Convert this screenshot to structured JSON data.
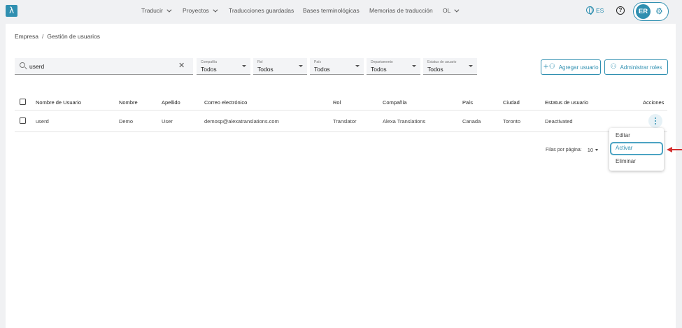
{
  "app": {
    "logo_glyph": "λ",
    "brand_color": "#2f8fb0"
  },
  "nav": {
    "items": [
      {
        "label": "Traducir",
        "has_dropdown": true
      },
      {
        "label": "Proyectos",
        "has_dropdown": true
      },
      {
        "label": "Traducciones guardadas",
        "has_dropdown": false
      },
      {
        "label": "Bases terminológicas",
        "has_dropdown": false
      },
      {
        "label": "Memorias de traducción",
        "has_dropdown": false
      },
      {
        "label": "OL",
        "has_dropdown": true
      }
    ],
    "language": "ES",
    "help_glyph": "?",
    "user_initials": "ER",
    "settings_icon": "gear-icon"
  },
  "breadcrumb": {
    "root": "Empresa",
    "separator": "/",
    "current": "Gestión de usuarios"
  },
  "search": {
    "value": "userd",
    "placeholder": ""
  },
  "filters": [
    {
      "label": "Compañía",
      "value": "Todos"
    },
    {
      "label": "Rol",
      "value": "Todos"
    },
    {
      "label": "País",
      "value": "Todos"
    },
    {
      "label": "Departamento",
      "value": "Todos"
    },
    {
      "label": "Estatus de usuario",
      "value": "Todos"
    }
  ],
  "actions": {
    "add_user": "Agregar usuario",
    "manage_roles": "Administrar roles"
  },
  "table": {
    "columns": [
      "Nombre de Usuario",
      "Nombre",
      "Apellido",
      "Correo electrónico",
      "Rol",
      "Compañía",
      "País",
      "Ciudad",
      "Estatus de usuario",
      "Acciones"
    ],
    "rows": [
      {
        "username": "userd",
        "first_name": "Demo",
        "last_name": "User",
        "email": "demosp@alexatranslations.com",
        "role": "Translator",
        "company": "Alexa Translations",
        "country": "Canada",
        "city": "Toronto",
        "status": "Deactivated"
      }
    ]
  },
  "pagination": {
    "label": "Filas por página:",
    "value": "10"
  },
  "row_menu": {
    "items": [
      "Editar",
      "Activar",
      "Eliminar"
    ],
    "highlighted": "Activar"
  },
  "annotation_color": "#d32f2f"
}
